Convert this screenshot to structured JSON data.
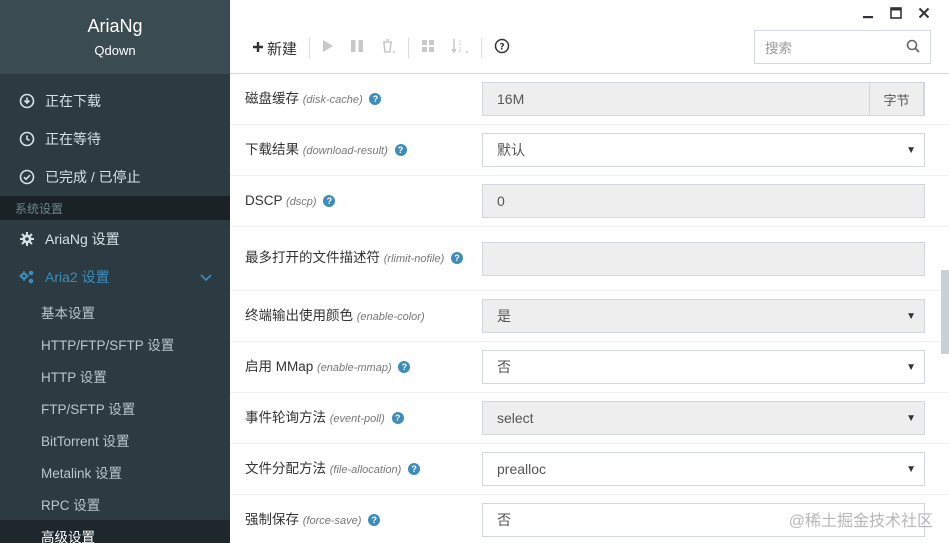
{
  "brand": {
    "title": "AriaNg",
    "subtitle": "Qdown"
  },
  "sidebar": {
    "tasks": [
      {
        "label": "正在下载",
        "icon": "download-circle-icon"
      },
      {
        "label": "正在等待",
        "icon": "clock-icon"
      },
      {
        "label": "已完成 / 已停止",
        "icon": "check-circle-icon"
      }
    ],
    "section_label": "系统设置",
    "settings": [
      {
        "label": "AriaNg 设置",
        "icon": "gear-icon"
      },
      {
        "label": "Aria2 设置",
        "icon": "gears-icon"
      }
    ],
    "aria2_sub": [
      {
        "label": "基本设置"
      },
      {
        "label": "HTTP/FTP/SFTP 设置"
      },
      {
        "label": "HTTP 设置"
      },
      {
        "label": "FTP/SFTP 设置"
      },
      {
        "label": "BitTorrent 设置"
      },
      {
        "label": "Metalink 设置"
      },
      {
        "label": "RPC 设置"
      },
      {
        "label": "高级设置"
      }
    ]
  },
  "toolbar": {
    "new_label": "新建",
    "search_placeholder": "搜索"
  },
  "options": [
    {
      "name": "磁盘缓存",
      "key": "(disk-cache)",
      "value": "16M",
      "addon": "字节",
      "type": "text-disabled"
    },
    {
      "name": "下载结果",
      "key": "(download-result)",
      "value": "默认",
      "type": "select"
    },
    {
      "name": "DSCP",
      "key": "(dscp)",
      "value": "0",
      "type": "text-disabled"
    },
    {
      "name": "最多打开的文件描述符",
      "key": "(rlimit-nofile)",
      "value": "",
      "type": "text-disabled"
    },
    {
      "name": "终端输出使用颜色",
      "key": "(enable-color)",
      "value": "是",
      "type": "select-disabled"
    },
    {
      "name": "启用 MMap",
      "key": "(enable-mmap)",
      "value": "否",
      "type": "select"
    },
    {
      "name": "事件轮询方法",
      "key": "(event-poll)",
      "value": "select",
      "type": "select-disabled"
    },
    {
      "name": "文件分配方法",
      "key": "(file-allocation)",
      "value": "prealloc",
      "type": "select"
    },
    {
      "name": "强制保存",
      "key": "(force-save)",
      "value": "否",
      "type": "select"
    }
  ],
  "watermark": "@稀土掘金技术社区"
}
